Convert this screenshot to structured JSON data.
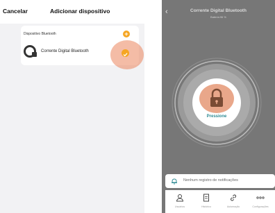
{
  "left_screen": {
    "header": {
      "cancel_label": "Cancelar",
      "title": "Adicionar dispositivo"
    },
    "card": {
      "section_label": "Dispositivo Bluetooth",
      "add_icon": "plus-icon",
      "device": {
        "name": "Corrente Digital Bluetooth",
        "icon": "bluetooth-lock-icon",
        "selected": true
      }
    },
    "colors": {
      "accent": "#f5a623",
      "highlight": "#eb855c"
    }
  },
  "right_screen": {
    "header": {
      "back_icon": "chevron-left-icon",
      "title": "Corrente Digital Bluetooth",
      "battery": "Bateria:96 %"
    },
    "lock": {
      "icon": "padlock-icon",
      "label": "Pressione"
    },
    "notification": {
      "icon": "bell-icon",
      "text": "Nenhum registro de notificações"
    },
    "tabs": [
      {
        "label": "Usuários",
        "icon": "user-icon"
      },
      {
        "label": "Histórico",
        "icon": "document-icon"
      },
      {
        "label": "Automação",
        "icon": "link-icon"
      },
      {
        "label": "Configurações",
        "icon": "more-dots-icon"
      }
    ],
    "colors": {
      "background": "#777777",
      "lock_accent": "#e9a78a",
      "label": "#2d8a93"
    }
  }
}
